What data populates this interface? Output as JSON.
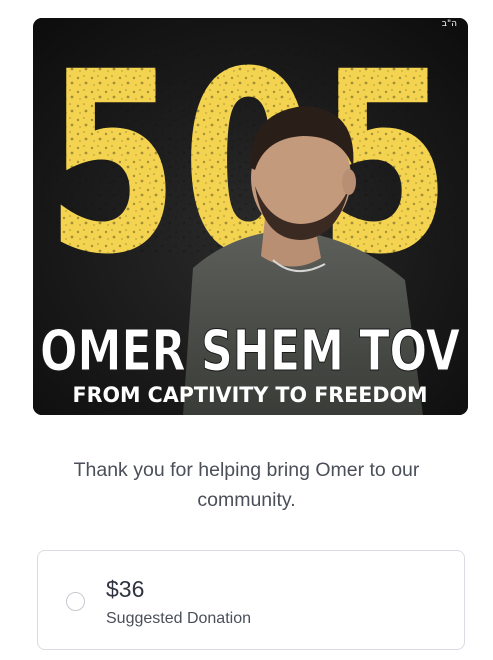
{
  "hero": {
    "big_number": "505",
    "name_banner": "OMER SHEM TOV",
    "tagline": "FROM CAPTIVITY TO FREEDOM",
    "corner_mark": "ה\"ב",
    "accent_color": "#f3d34f"
  },
  "thanks_text": "Thank you for helping bring Omer to our community.",
  "donation_option": {
    "amount": "$36",
    "label": "Suggested Donation",
    "selected": false
  }
}
